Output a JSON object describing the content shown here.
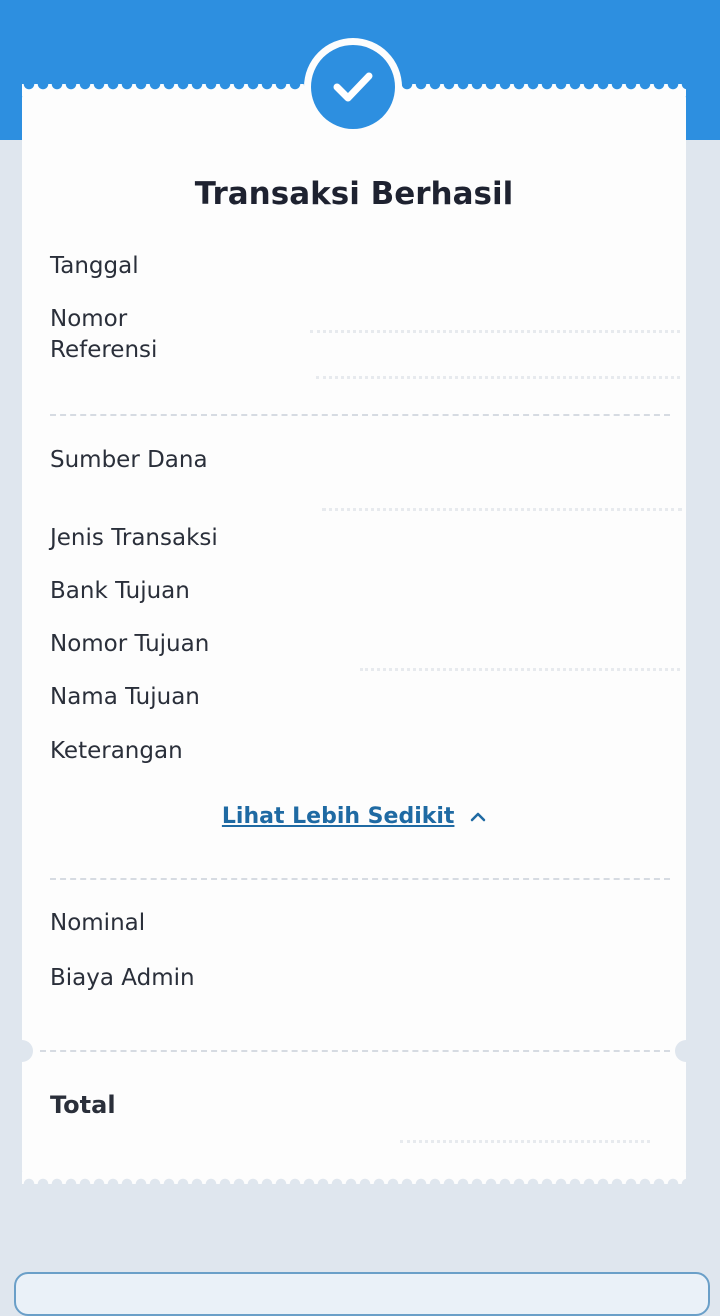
{
  "receipt": {
    "title": "Transaksi Berhasil",
    "fields": {
      "date_label": "Tanggal",
      "reference_label": "Nomor\nReferensi",
      "source_label": "Sumber Dana",
      "type_label": "Jenis Transaksi",
      "bank_label": "Bank Tujuan",
      "account_label": "Nomor Tujuan",
      "name_label": "Nama Tujuan",
      "note_label": "Keterangan",
      "amount_label": "Nominal",
      "fee_label": "Biaya Admin",
      "total_label": "Total"
    },
    "see_less_link": "Lihat Lebih Sedikit"
  },
  "icons": {
    "status": "checkmark-icon",
    "toggle": "chevron-up-icon"
  },
  "colors": {
    "accent": "#2d8fe0",
    "link": "#1f6aa3",
    "background": "#dfe6ee"
  }
}
